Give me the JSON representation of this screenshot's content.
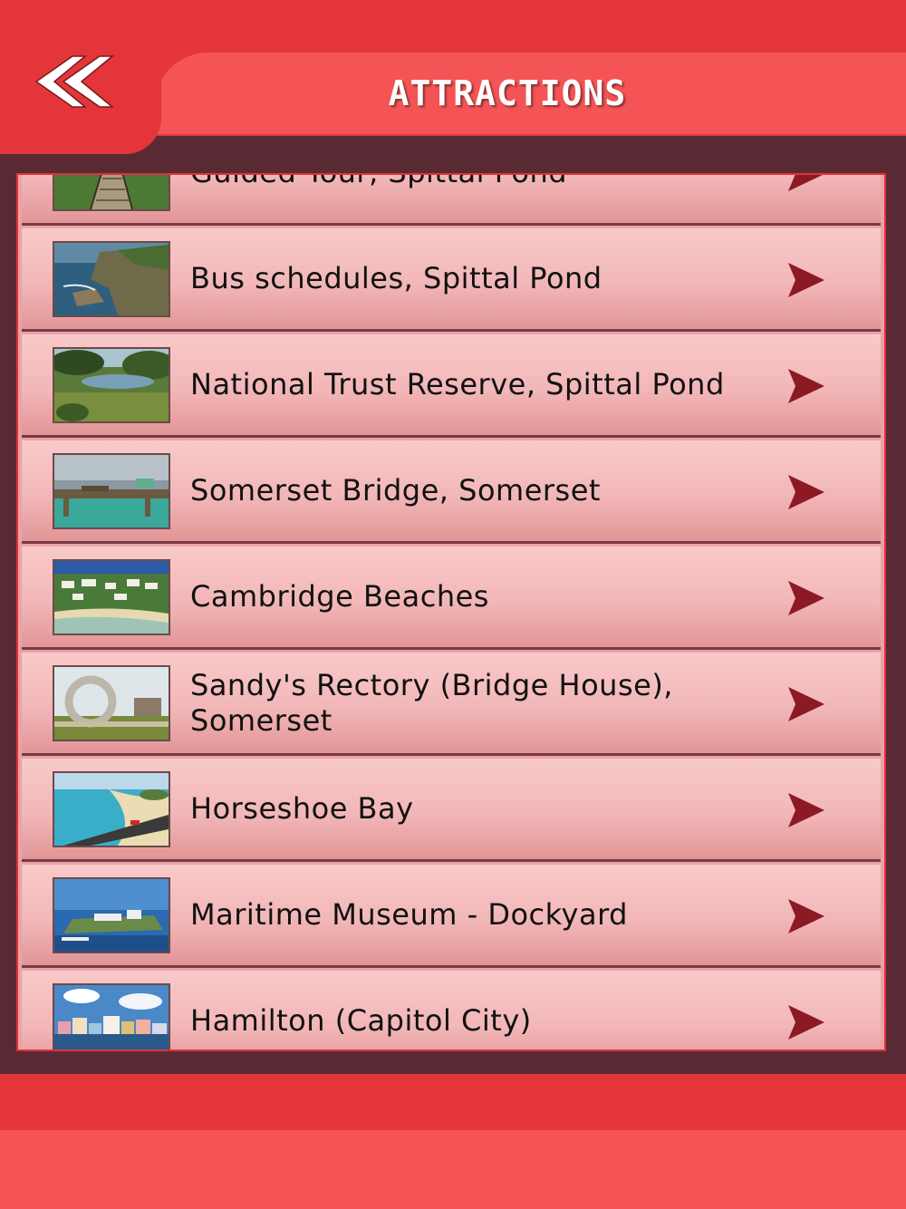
{
  "header": {
    "title": "ATTRACTIONS",
    "back_icon": "double-chevron-left-icon",
    "colors": {
      "primary": "#e4363a",
      "secondary": "#f45455",
      "panel": "#5a2a34"
    }
  },
  "list": {
    "items": [
      {
        "label": "Guided Tour, Spittal Pond",
        "thumb": "boardwalk"
      },
      {
        "label": "Bus schedules, Spittal Pond",
        "thumb": "rocky-coast"
      },
      {
        "label": "National Trust Reserve, Spittal Pond",
        "thumb": "pond"
      },
      {
        "label": "Somerset Bridge, Somerset",
        "thumb": "bridge"
      },
      {
        "label": "Cambridge Beaches",
        "thumb": "resort"
      },
      {
        "label": "Sandy's Rectory (Bridge House), Somerset",
        "thumb": "moongate"
      },
      {
        "label": "Horseshoe Bay",
        "thumb": "beach"
      },
      {
        "label": "Maritime Museum - Dockyard",
        "thumb": "fort"
      },
      {
        "label": "Hamilton (Capitol City)",
        "thumb": "town"
      }
    ],
    "arrow_icon": "play-arrow-icon"
  }
}
